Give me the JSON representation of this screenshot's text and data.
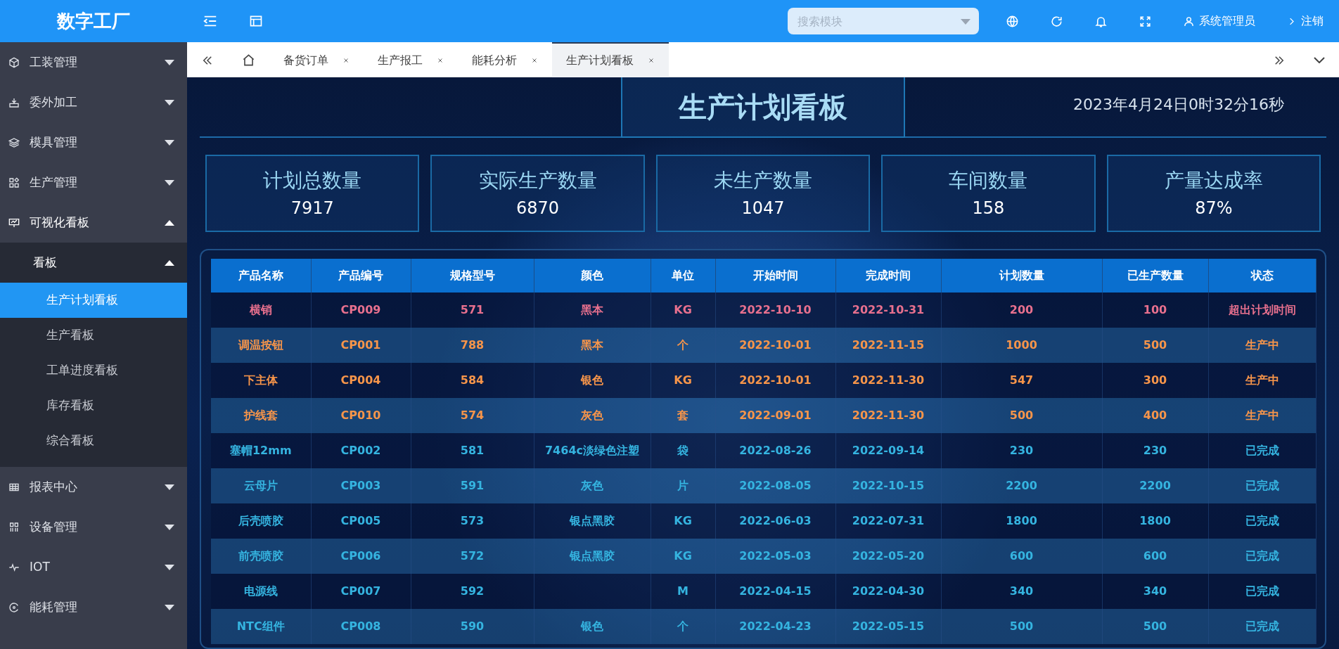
{
  "app": {
    "title": "数字工厂",
    "search": {
      "placeholder": "搜索模块"
    },
    "user": "系统管理员",
    "logout": "注销"
  },
  "sidebar": {
    "items": [
      {
        "label": "工装管理",
        "expanded": false
      },
      {
        "label": "委外加工",
        "expanded": false
      },
      {
        "label": "模具管理",
        "expanded": false
      },
      {
        "label": "生产管理",
        "expanded": false
      },
      {
        "label": "可视化看板",
        "expanded": true,
        "children": [
          {
            "label": "看板",
            "expanded": true,
            "children": [
              {
                "label": "生产计划看板",
                "selected": true
              },
              {
                "label": "生产看板",
                "selected": false
              },
              {
                "label": "工单进度看板",
                "selected": false
              },
              {
                "label": "库存看板",
                "selected": false
              },
              {
                "label": "综合看板",
                "selected": false
              }
            ]
          }
        ]
      },
      {
        "label": "报表中心",
        "expanded": false
      },
      {
        "label": "设备管理",
        "expanded": false
      },
      {
        "label": "IOT",
        "expanded": false
      },
      {
        "label": "能耗管理",
        "expanded": false
      }
    ]
  },
  "tabs": [
    {
      "label": "备货订单",
      "selected": false
    },
    {
      "label": "生产报工",
      "selected": false
    },
    {
      "label": "能耗分析",
      "selected": false
    },
    {
      "label": "生产计划看板",
      "selected": true
    }
  ],
  "dashboard": {
    "title": "生产计划看板",
    "datetime": "2023年4月24日0时32分16秒",
    "stats": [
      {
        "label": "计划总数量",
        "value": "7917"
      },
      {
        "label": "实际生产数量",
        "value": "6870"
      },
      {
        "label": "未生产数量",
        "value": "1047"
      },
      {
        "label": "车间数量",
        "value": "158"
      },
      {
        "label": "产量达成率",
        "value": "87%"
      }
    ],
    "table": {
      "columns": [
        "产品名称",
        "产品编号",
        "规格型号",
        "颜色",
        "单位",
        "开始时间",
        "完成时间",
        "计划数量",
        "已生产数量",
        "状态"
      ],
      "rows": [
        {
          "kind": "overdue",
          "cells": [
            "横销",
            "CP009",
            "571",
            "黑本",
            "KG",
            "2022-10-10",
            "2022-10-31",
            "200",
            "100",
            "超出计划时间"
          ]
        },
        {
          "kind": "running",
          "cells": [
            "调温按钮",
            "CP001",
            "788",
            "黑本",
            "个",
            "2022-10-01",
            "2022-11-15",
            "1000",
            "500",
            "生产中"
          ]
        },
        {
          "kind": "running",
          "cells": [
            "下主体",
            "CP004",
            "584",
            "银色",
            "KG",
            "2022-10-01",
            "2022-11-30",
            "547",
            "300",
            "生产中"
          ]
        },
        {
          "kind": "running",
          "cells": [
            "护线套",
            "CP010",
            "574",
            "灰色",
            "套",
            "2022-09-01",
            "2022-11-30",
            "500",
            "400",
            "生产中"
          ]
        },
        {
          "kind": "done",
          "cells": [
            "塞帽12mm",
            "CP002",
            "581",
            "7464c淡绿色注塑",
            "袋",
            "2022-08-26",
            "2022-09-14",
            "230",
            "230",
            "已完成"
          ]
        },
        {
          "kind": "done",
          "cells": [
            "云母片",
            "CP003",
            "591",
            "灰色",
            "片",
            "2022-08-05",
            "2022-10-15",
            "2200",
            "2200",
            "已完成"
          ]
        },
        {
          "kind": "done",
          "cells": [
            "后壳喷胶",
            "CP005",
            "573",
            "银点黑胶",
            "KG",
            "2022-06-03",
            "2022-07-31",
            "1800",
            "1800",
            "已完成"
          ]
        },
        {
          "kind": "done",
          "cells": [
            "前壳喷胶",
            "CP006",
            "572",
            "银点黑胶",
            "KG",
            "2022-05-03",
            "2022-05-20",
            "600",
            "600",
            "已完成"
          ]
        },
        {
          "kind": "done",
          "cells": [
            "电源线",
            "CP007",
            "592",
            null,
            "M",
            "2022-04-15",
            "2022-04-30",
            "340",
            "340",
            "已完成"
          ]
        },
        {
          "kind": "done",
          "cells": [
            "NTC组件",
            "CP008",
            "590",
            "银色",
            "个",
            "2022-04-23",
            "2022-05-15",
            "500",
            "500",
            "已完成"
          ]
        }
      ]
    }
  }
}
